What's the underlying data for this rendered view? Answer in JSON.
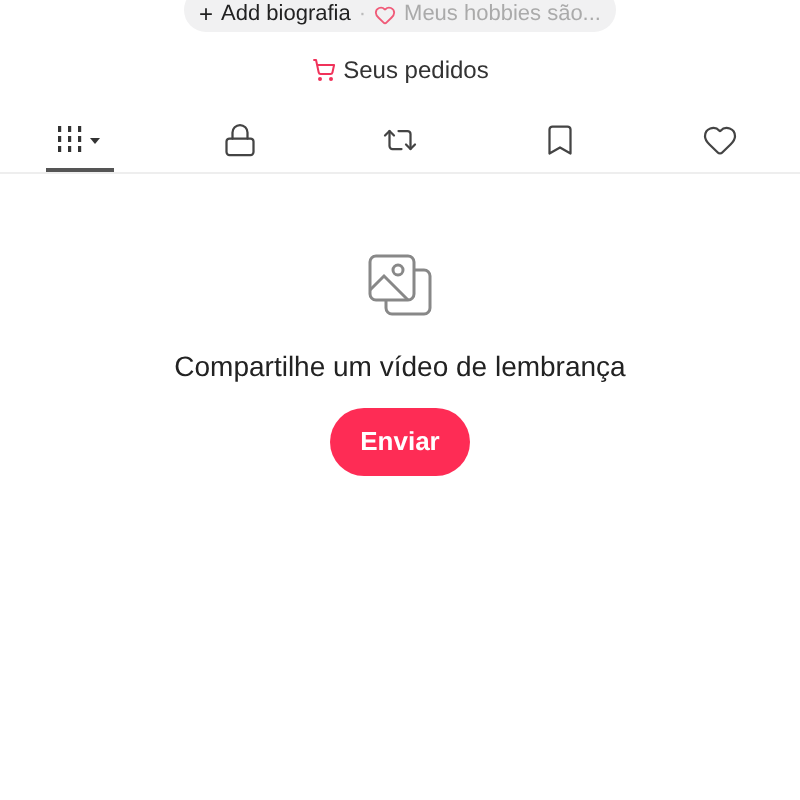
{
  "profile_chips": {
    "add_bio": {
      "icon": "+",
      "label": "Add biografia"
    },
    "separator": "·",
    "hobbies": {
      "label": "Meus hobbies são..."
    }
  },
  "orders_link": {
    "label": "Seus pedidos"
  },
  "tabs": [
    {
      "kind": "videos",
      "selected": true
    },
    {
      "kind": "private",
      "selected": false
    },
    {
      "kind": "reposts",
      "selected": false
    },
    {
      "kind": "saved",
      "selected": false
    },
    {
      "kind": "liked",
      "selected": false
    }
  ],
  "empty_state": {
    "message": "Compartilhe um vídeo de lembrança",
    "button": "Enviar"
  }
}
